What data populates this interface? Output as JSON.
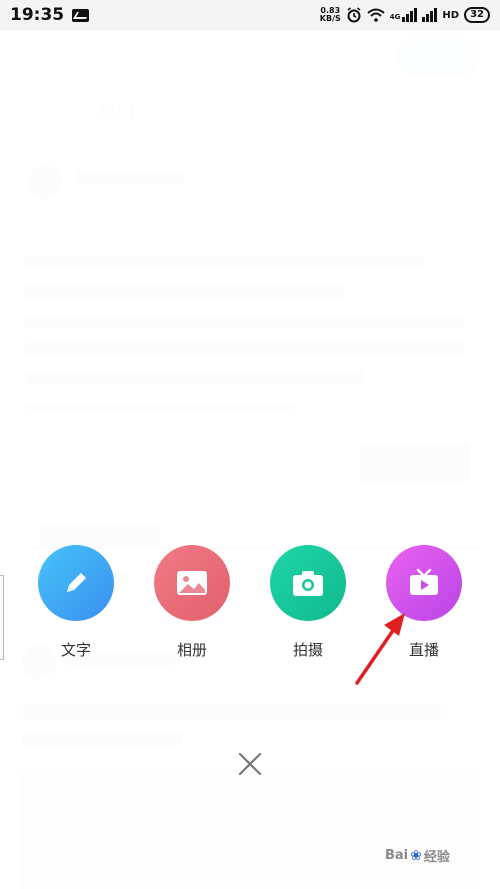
{
  "status_bar": {
    "time": "19:35",
    "net_speed_value": "0.83",
    "net_speed_unit": "KB/S",
    "network_label": "4G",
    "network_label_2": "HD",
    "battery": "32"
  },
  "background": {
    "title_fragment": "热门"
  },
  "actions": [
    {
      "label": "文字",
      "icon": "pencil-icon",
      "color": "#39a6f0"
    },
    {
      "label": "相册",
      "icon": "image-icon",
      "color": "#ea6b7a"
    },
    {
      "label": "拍摄",
      "icon": "camera-icon",
      "color": "#14c69a"
    },
    {
      "label": "直播",
      "icon": "tv-play-icon",
      "color": "#d24fe6"
    }
  ],
  "close_icon": "close-icon",
  "watermark": {
    "text": "Bai",
    "suffix": "经验"
  }
}
